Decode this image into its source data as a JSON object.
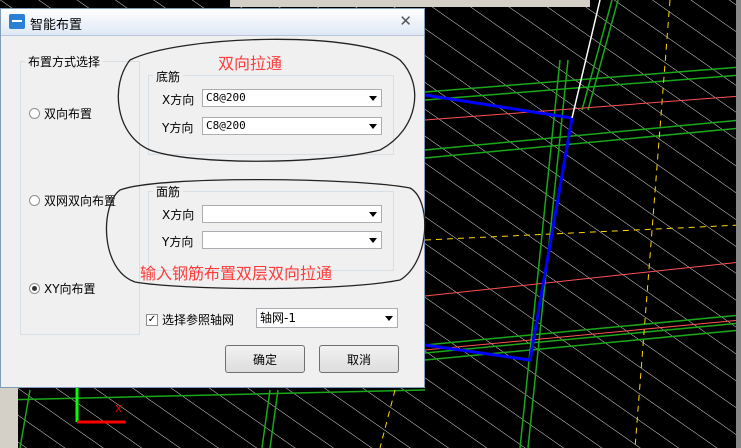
{
  "dialog": {
    "title": "智能布置",
    "close_glyph": "✕",
    "layout_group_label": "布置方式选择",
    "radios": [
      {
        "label": "双向布置",
        "selected": false
      },
      {
        "label": "双网双向布置",
        "selected": false
      },
      {
        "label": "XY向布置",
        "selected": true
      }
    ],
    "bottom_group": {
      "label": "底筋",
      "x_label": "X方向",
      "x_value": "C8@200",
      "y_label": "Y方向",
      "y_value": "C8@200"
    },
    "top_group": {
      "label": "面筋",
      "x_label": "X方向",
      "x_value": "",
      "y_label": "Y方向",
      "y_value": ""
    },
    "checkbox": {
      "label": "选择参照轴网",
      "checked": true,
      "mark": "✓"
    },
    "axis_select_value": "轴网-1",
    "ok_label": "确定",
    "cancel_label": "取消"
  },
  "annotations": {
    "top": "双向拉通",
    "bottom": "输入钢筋布置双层双向拉通"
  },
  "colors": {
    "annotation": "#ff3b3b",
    "beam_green": "#1aa81a",
    "beam_blue": "#0000ff",
    "hatch": "#ffffff"
  }
}
